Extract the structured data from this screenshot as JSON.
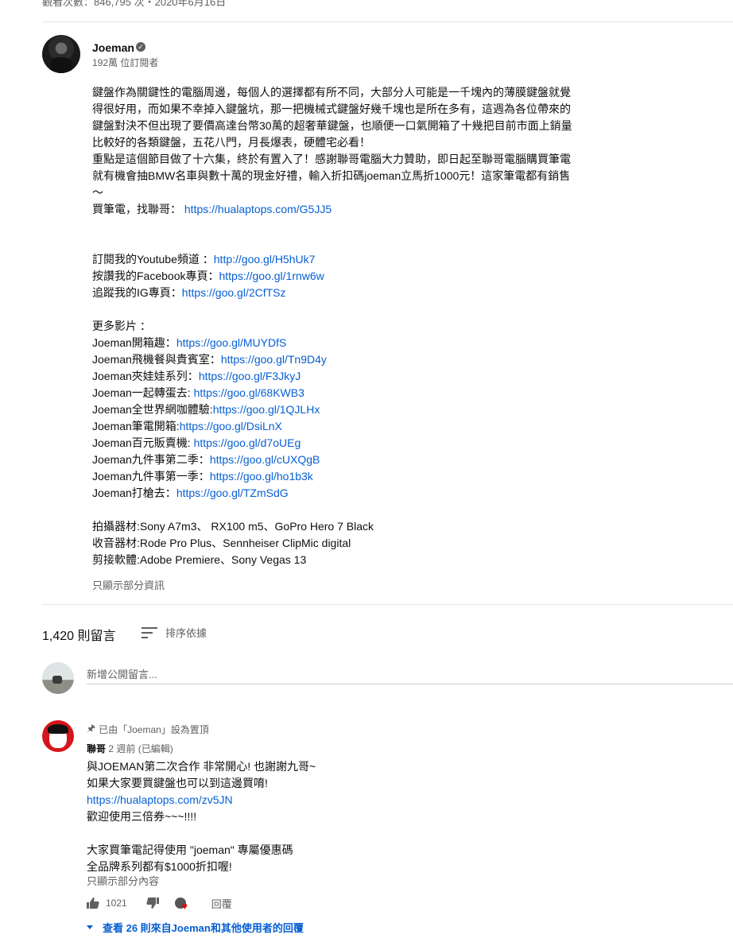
{
  "video_meta": {
    "views_date": "觀看次數：846,795 次・2020年6月16日"
  },
  "channel": {
    "name": "Joeman",
    "subscribers": "192萬 位訂閱者"
  },
  "description": {
    "paragraph1": "鍵盤作為關鍵性的電腦周邊，每個人的選擇都有所不同，大部分人可能是一千塊內的薄膜鍵盤就覺得很好用，而如果不幸掉入鍵盤坑，那一把機械式鍵盤好幾千塊也是所在多有，這週為各位帶來的鍵盤對決不但出現了要價高達台幣30萬的超奢華鍵盤，也順便一口氣開箱了十幾把目前市面上銷量比較好的各類鍵盤，五花八門，月長爆表，硬體宅必看！",
    "paragraph2": "重點是這個節目做了十六集，終於有置入了！感謝聯哥電腦大力贊助，即日起至聯哥電腦購買筆電就有機會抽BMW名車與數十萬的現金好禮，輸入折扣碼joeman立馬折1000元！這家筆電都有銷售～",
    "buy_label": "買筆電，找聯哥：",
    "buy_link": "https://hualaptops.com/G5JJ5",
    "social": [
      {
        "label": "訂閱我的Youtube頻道 ：",
        "url": "http://goo.gl/H5hUk7"
      },
      {
        "label": "按讚我的Facebook專頁：",
        "url": "https://goo.gl/1rnw6w"
      },
      {
        "label": "追蹤我的IG專頁：",
        "url": "https://goo.gl/2CfTSz"
      }
    ],
    "more_videos_title": "更多影片 ：",
    "more_videos": [
      {
        "label": "Joeman開箱趣：",
        "url": "https://goo.gl/MUYDfS"
      },
      {
        "label": "Joeman飛機餐與貴賓室：",
        "url": "https://goo.gl/Tn9D4y"
      },
      {
        "label": "Joeman夾娃娃系列：",
        "url": "https://goo.gl/F3JkyJ"
      },
      {
        "label": "Joeman一起轉蛋去: ",
        "url": "https://goo.gl/68KWB3"
      },
      {
        "label": "Joeman全世界網咖體驗:",
        "url": "https://goo.gl/1QJLHx"
      },
      {
        "label": "Joeman筆電開箱:",
        "url": "https://goo.gl/DsiLnX"
      },
      {
        "label": "Joeman百元販賣機: ",
        "url": "https://goo.gl/d7oUEg"
      },
      {
        "label": "Joeman九件事第二季：",
        "url": "https://goo.gl/cUXQgB"
      },
      {
        "label": "Joeman九件事第一季：",
        "url": "https://goo.gl/ho1b3k"
      },
      {
        "label": "Joeman打槍去：",
        "url": "https://goo.gl/TZmSdG"
      }
    ],
    "gear": [
      "拍攝器材:Sony A7m3、 RX100 m5、GoPro Hero 7 Black",
      "收音器材:Rode Pro Plus、Sennheiser ClipMic digital",
      "剪接軟體:Adobe Premiere、Sony Vegas 13"
    ],
    "show_less": "只顯示部分資訊"
  },
  "comments_header": {
    "count": "1,420 則留言",
    "sort_label": "排序依據"
  },
  "add_comment": {
    "placeholder": "新增公開留言..."
  },
  "pinned_comment": {
    "pinned_label": "已由「Joeman」設為置頂",
    "author": "聯哥",
    "meta": "2 週前 (已編輯)",
    "lines": [
      "與JOEMAN第二次合作 非常開心! 也謝謝九哥~",
      "如果大家要買鍵盤也可以到這邊買唷!",
      "https://hualaptops.com/zv5JN",
      "歡迎使用三倍券~~~!!!!",
      "",
      "大家買筆電記得使用 \"joeman\" 專屬優惠碼",
      "全品牌系列都有$1000折扣喔!"
    ],
    "show_more": "只顯示部分內容",
    "likes": "1021",
    "reply_label": "回覆",
    "view_replies": "查看 26 則來自Joeman和其他使用者的回覆"
  }
}
